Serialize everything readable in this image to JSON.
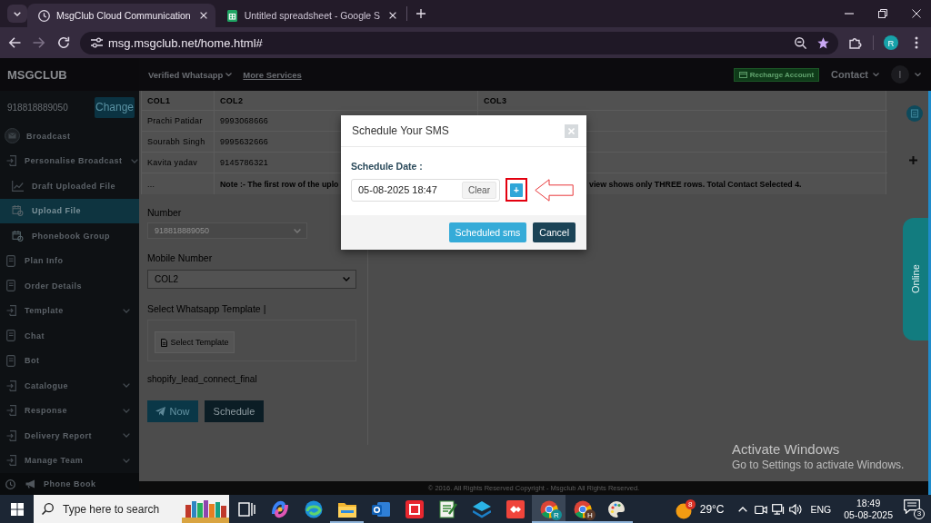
{
  "browser": {
    "tabs": [
      {
        "title": "MsgClub Cloud Communication",
        "selected": true
      },
      {
        "title": "Untitled spreadsheet - Google S",
        "selected": false
      }
    ],
    "url": "msg.msgclub.net/home.html#",
    "profile_initial": "R"
  },
  "header": {
    "brand": "MSGCLUB",
    "nav": [
      {
        "label": "Verified Whatsapp",
        "kind": "dropdown"
      },
      {
        "label": "More Services",
        "kind": "link"
      }
    ],
    "recharge": "Recharge Account",
    "contact": "Contact",
    "user_initial": "I"
  },
  "sidebar": {
    "number": "918818889050",
    "change": "Change",
    "items": [
      {
        "label": "Broadcast",
        "kind": "link",
        "selected": false
      },
      {
        "label": "Personalise Broadcast",
        "kind": "group",
        "selected": false,
        "children": [
          {
            "label": "Draft Uploaded File",
            "selected": false
          },
          {
            "label": "Upload File",
            "selected": true
          },
          {
            "label": "Phonebook Group",
            "selected": false
          }
        ]
      },
      {
        "label": "Plan Info",
        "kind": "link",
        "selected": false
      },
      {
        "label": "Order Details",
        "kind": "link",
        "selected": false
      },
      {
        "label": "Template",
        "kind": "group",
        "selected": false
      },
      {
        "label": "Chat",
        "kind": "link",
        "selected": false
      },
      {
        "label": "Bot",
        "kind": "link",
        "selected": false
      },
      {
        "label": "Catalogue",
        "kind": "group",
        "selected": false
      },
      {
        "label": "Response",
        "kind": "group",
        "selected": false
      },
      {
        "label": "Delivery Report",
        "kind": "group",
        "selected": false
      },
      {
        "label": "Manage Team",
        "kind": "group",
        "selected": false
      }
    ],
    "footer_item": "Phone Book"
  },
  "table": {
    "columns": [
      "COL1",
      "COL2",
      "COL3"
    ],
    "rows": [
      {
        "col1": "Prachi Patidar",
        "col2": "9993068666"
      },
      {
        "col1": "Sourabh Singh",
        "col2": "9995632666"
      },
      {
        "col1": "Kavita yadav",
        "col2": "9145786321"
      }
    ],
    "note_row": {
      "col1": "...",
      "note_start": "Note :- The first row of the uplo",
      "note_end": "view shows only THREE rows. Total Contact Selected 4."
    }
  },
  "form": {
    "fields": [
      {
        "label": "Number",
        "value": "918818889050",
        "disabled": true
      },
      {
        "label": "Mobile Number",
        "value": "COL2",
        "disabled": false
      }
    ],
    "template_label": "Select Whatsapp Template |",
    "template_button": "Select Template",
    "template_name": "shopify_lead_connect_final",
    "actions": [
      {
        "label": "Now",
        "kind": "primary"
      },
      {
        "label": "Schedule",
        "kind": "secondary"
      }
    ]
  },
  "side_tab": "Online",
  "modal": {
    "title": "Schedule Your SMS",
    "date_label": "Schedule Date :",
    "date_value": "05-08-2025 18:47",
    "clear": "Clear",
    "add": "+",
    "buttons": [
      {
        "label": "Scheduled sms",
        "kind": "primary"
      },
      {
        "label": "Cancel",
        "kind": "dark"
      }
    ]
  },
  "footer": {
    "copyright": "© 2016. All Rights Reserved Copyright - Msgclub All Rights Reserved."
  },
  "os_notice": {
    "title": "Activate Windows",
    "text": "Go to Settings to activate Windows."
  },
  "taskbar": {
    "search_placeholder": "Type here to search",
    "apps": [
      {
        "selected": false,
        "running": false
      },
      {
        "selected": false,
        "running": false
      },
      {
        "selected": false,
        "running": false
      },
      {
        "selected": false,
        "running": true
      },
      {
        "selected": false,
        "running": false
      },
      {
        "selected": false,
        "running": false
      },
      {
        "selected": false,
        "running": false
      },
      {
        "selected": false,
        "running": false
      },
      {
        "selected": false,
        "running": false
      },
      {
        "selected": true,
        "running": true,
        "badge": "R"
      },
      {
        "selected": false,
        "running": true,
        "badge": "H"
      },
      {
        "selected": false,
        "running": true
      }
    ],
    "weather": {
      "badge": "8",
      "temperature": "29°C"
    },
    "language": "ENG",
    "time": "18:49",
    "date": "05-08-2025",
    "notifications": "3"
  }
}
